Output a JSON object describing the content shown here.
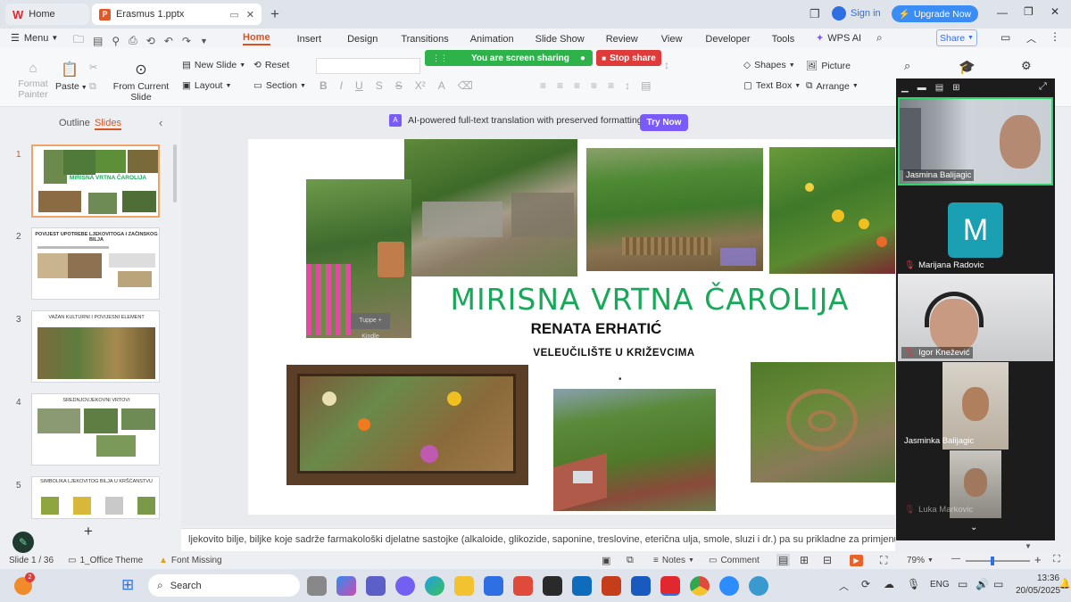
{
  "titlebar": {
    "home_tab": "Home",
    "file_tab": "Erasmus 1.pptx",
    "sign_in": "Sign in",
    "upgrade": "Upgrade Now"
  },
  "menubar": {
    "menu": "Menu",
    "tabs": [
      "Home",
      "Insert",
      "Design",
      "Transitions",
      "Animation",
      "Slide Show",
      "Review",
      "View",
      "Developer",
      "Tools"
    ],
    "wps_ai": "WPS AI",
    "share": "Share"
  },
  "ribbon": {
    "format_painter": "Format Painter",
    "paste": "Paste",
    "from_current_slide": "From Current Slide",
    "new_slide": "New Slide",
    "layout": "Layout",
    "reset": "Reset",
    "section": "Section",
    "shapes": "Shapes",
    "picture": "Picture",
    "text_box": "Text Box",
    "arrange": "Arrange"
  },
  "screen_share": {
    "status": "You are screen sharing",
    "stop": "Stop share"
  },
  "panel": {
    "outline": "Outline",
    "slides": "Slides"
  },
  "ai_banner": {
    "text": "AI-powered full-text translation with preserved formatting.",
    "button": "Try Now"
  },
  "thumbnails": [
    {
      "num": "1",
      "title": "MIRISNA VRTNA ČAROLIJA"
    },
    {
      "num": "2",
      "title": "POVIJEST UPOTREBE LJEKOVITOGA I ZAČINSKOG BILJA"
    },
    {
      "num": "3",
      "title": "VAŽAN KULTURNI I POVIJESNI ELEMENT"
    },
    {
      "num": "4",
      "title": "SREDNJOVJEKOVNI VRTOVI"
    },
    {
      "num": "5",
      "title": "SIMBOLIKA LJEKOVITOG BILJA U KRŠĆANSTVU"
    }
  ],
  "slide": {
    "title": "MIRISNA VRTNA ČAROLIJA",
    "author": "RENATA ERHATIĆ",
    "institution": "VELEUČILIŠTE U KRIŽEVCIMA",
    "sign": "Tuppe + Kindle"
  },
  "notes": "ljekovito bilje, biljke koje sadrže farmakološki djelatne sastojke (alkaloide, glikozide, saponine, treslovine, eterična ulja, smole, sluzi i dr.) pa su prikladne za primjenu u medicini i za pripremu ljekovitih biljnih",
  "statusbar": {
    "slide": "Slide 1 / 36",
    "theme": "1_Office Theme",
    "font": "Font Missing",
    "notes": "Notes",
    "comment": "Comment",
    "zoom": "79%"
  },
  "participants": [
    {
      "name": "Jasmina Balijagic",
      "muted": false
    },
    {
      "name": "Marijana Radovic",
      "initial": "M",
      "muted": true
    },
    {
      "name": "Igor Knežević",
      "muted": true
    },
    {
      "name": "Jasminka Balijagic",
      "muted": false
    },
    {
      "name": "Luka Markovic",
      "muted": true
    }
  ],
  "taskbar": {
    "search": "Search",
    "lang": "ENG",
    "time": "13:36",
    "date": "20/05/2025",
    "badge": "2"
  },
  "colors": {
    "accent": "#d9531e",
    "slide_title": "#19a85a",
    "share_green": "#2db34a",
    "stop_red": "#e03b3b",
    "ai_purple": "#7a5af8"
  }
}
